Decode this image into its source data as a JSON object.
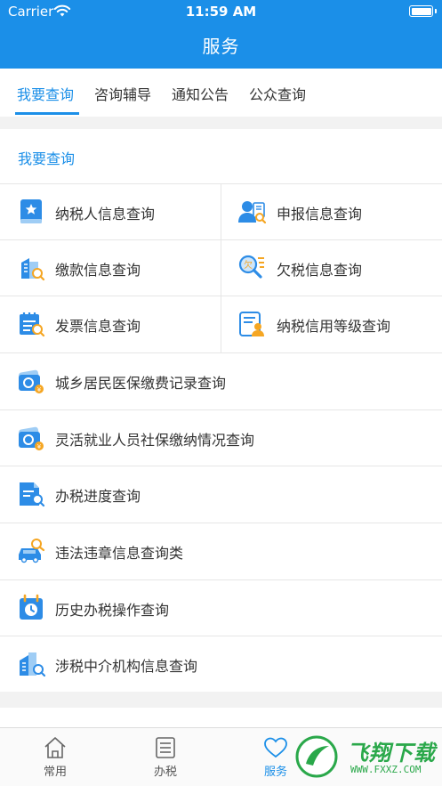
{
  "status_bar": {
    "carrier": "Carrier",
    "time": "11:59 AM"
  },
  "nav": {
    "title": "服务"
  },
  "tabs": [
    {
      "label": "我要查询",
      "active": true
    },
    {
      "label": "咨询辅导",
      "active": false
    },
    {
      "label": "通知公告",
      "active": false
    },
    {
      "label": "公众查询",
      "active": false
    }
  ],
  "section": {
    "title": "我要查询",
    "grid_items": [
      {
        "label": "纳税人信息查询",
        "icon": "taxpayer-book-icon"
      },
      {
        "label": "申报信息查询",
        "icon": "declaration-person-icon"
      },
      {
        "label": "缴款信息查询",
        "icon": "payment-building-icon"
      },
      {
        "label": "欠税信息查询",
        "icon": "arrears-search-icon"
      },
      {
        "label": "发票信息查询",
        "icon": "invoice-calendar-icon"
      },
      {
        "label": "纳税信用等级查询",
        "icon": "credit-rating-icon"
      }
    ],
    "list_items": [
      {
        "label": "城乡居民医保缴费记录查询",
        "icon": "medical-insurance-card-icon"
      },
      {
        "label": "灵活就业人员社保缴纳情况查询",
        "icon": "social-security-card-icon"
      },
      {
        "label": "办税进度查询",
        "icon": "progress-document-icon"
      },
      {
        "label": "违法违章信息查询类",
        "icon": "car-violation-icon"
      },
      {
        "label": "历史办税操作查询",
        "icon": "history-clock-icon"
      },
      {
        "label": "涉税中介机构信息查询",
        "icon": "agency-building-icon"
      }
    ]
  },
  "bottom_tabs": [
    {
      "label": "常用",
      "icon": "home-icon",
      "active": false
    },
    {
      "label": "办税",
      "icon": "list-icon",
      "active": false
    },
    {
      "label": "服务",
      "icon": "heart-icon",
      "active": true
    }
  ],
  "watermark": {
    "text": "飞翔下载",
    "url": "WWW.FXXZ.COM"
  },
  "colors": {
    "primary": "#1b8fe8",
    "icon_orange": "#f5a623",
    "background": "#f2f2f2"
  }
}
